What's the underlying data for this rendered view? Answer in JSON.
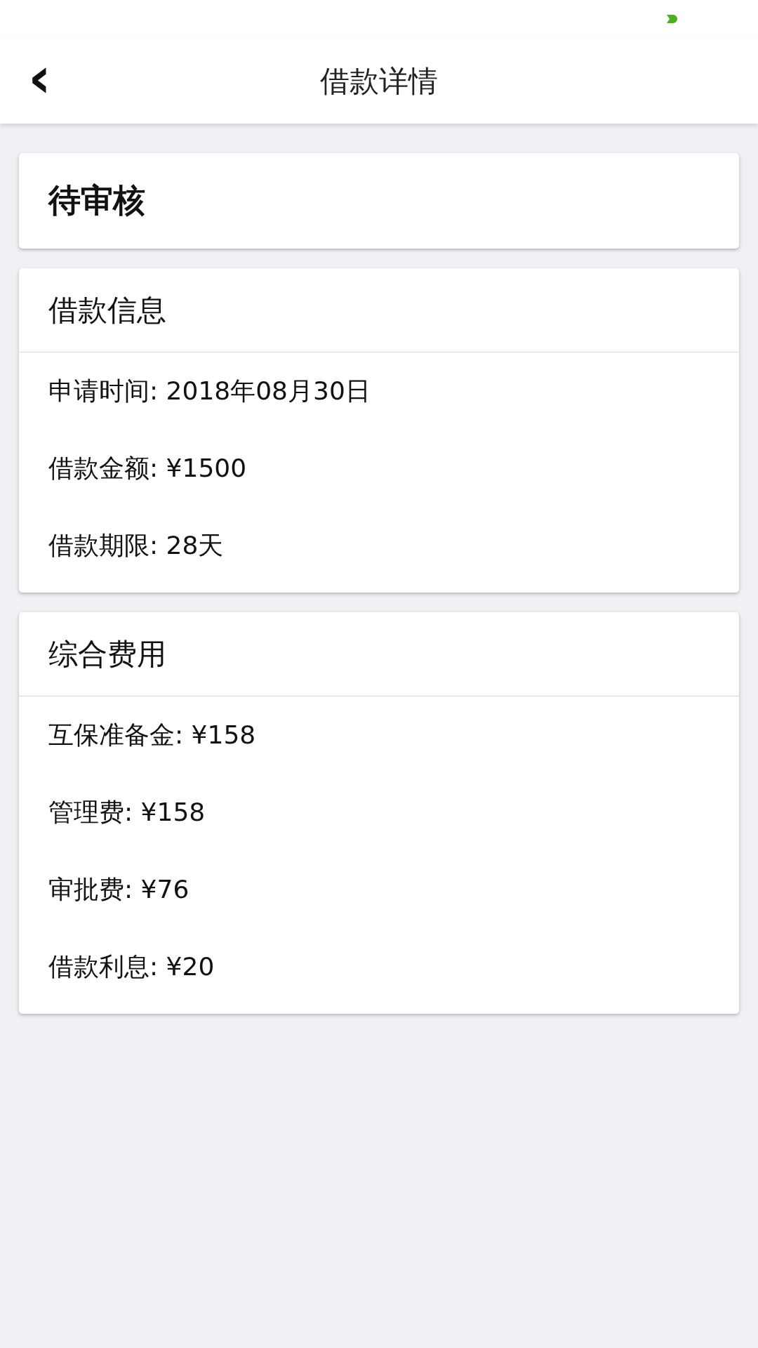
{
  "header": {
    "back": "‹",
    "title": "借款详情"
  },
  "status": {
    "text": "待审核"
  },
  "sections": [
    {
      "title": "借款信息",
      "rows": [
        {
          "text": "申请时间: 2018年08月30日"
        },
        {
          "text": "借款金额: ¥1500"
        },
        {
          "text": "借款期限: 28天"
        }
      ]
    },
    {
      "title": "综合费用",
      "rows": [
        {
          "text": "互保准备金: ¥158"
        },
        {
          "text": "管理费: ¥158"
        },
        {
          "text": "审批费: ¥76"
        },
        {
          "text": "借款利息: ¥20"
        }
      ]
    }
  ]
}
